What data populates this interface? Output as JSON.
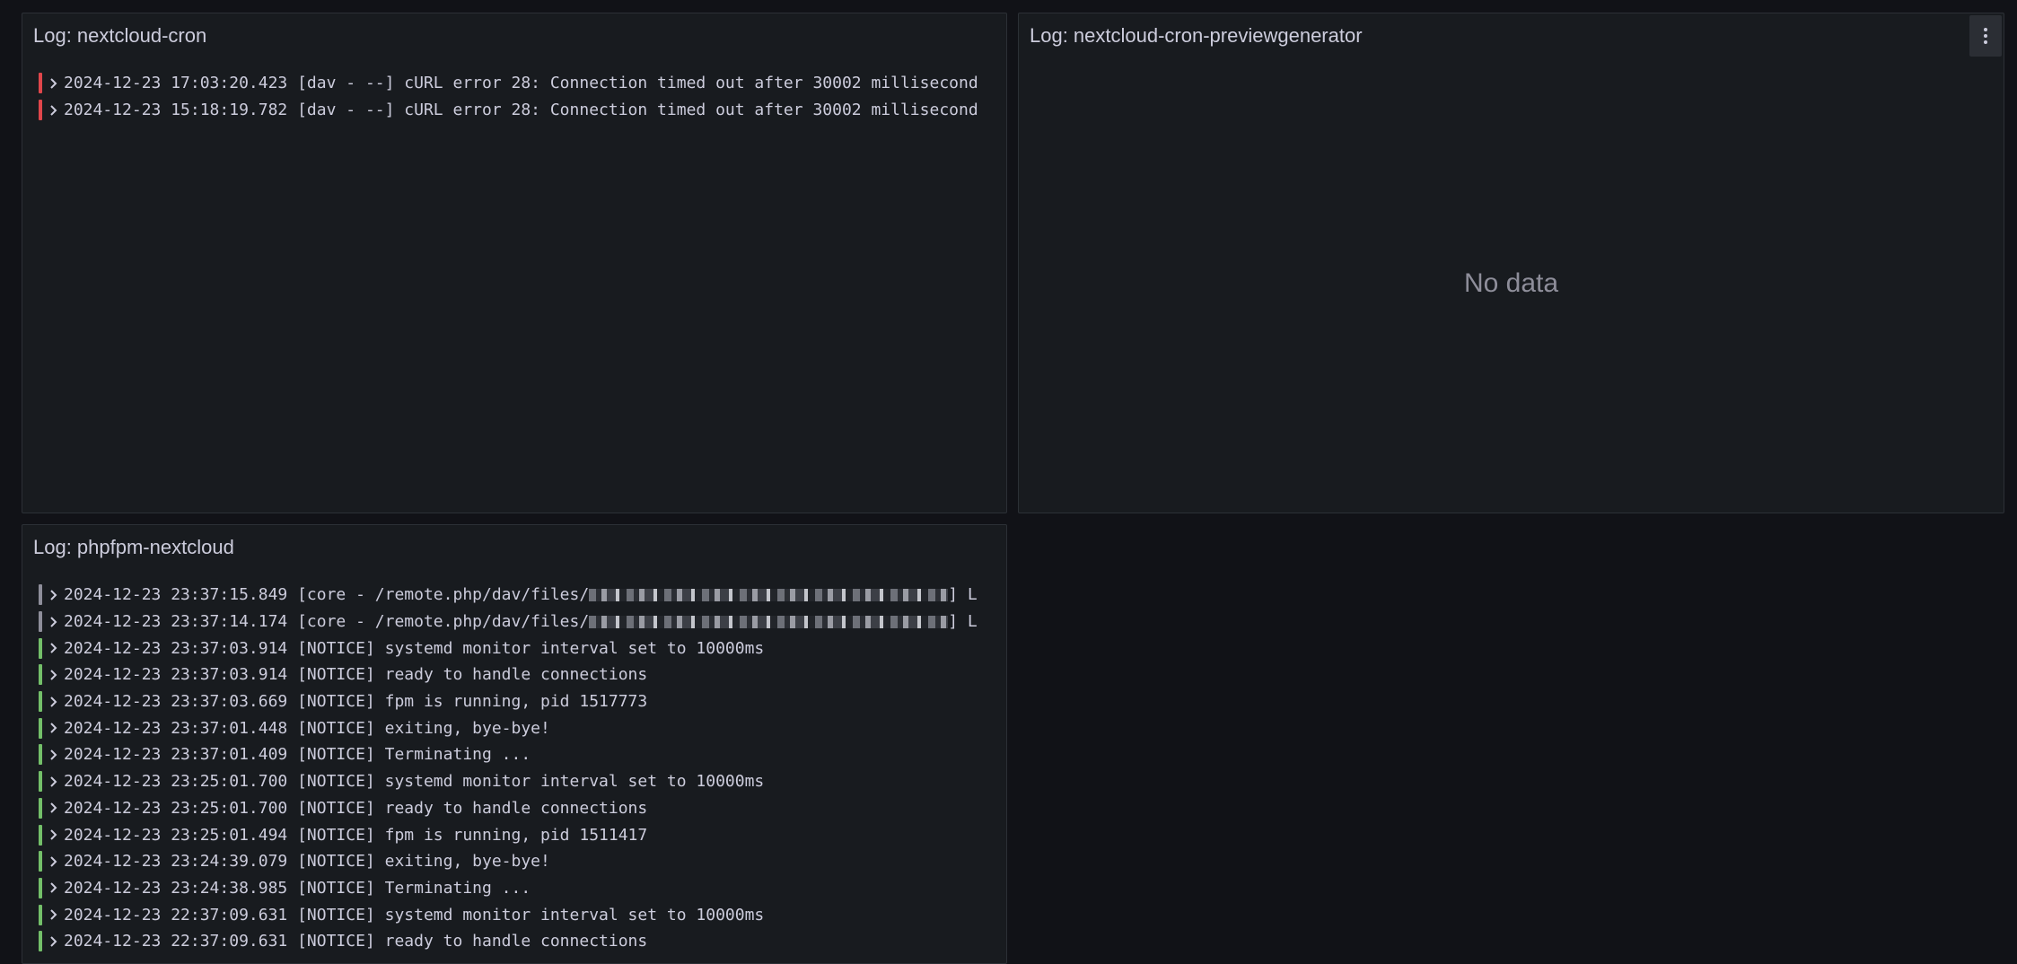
{
  "colors": {
    "error": "#e0464b",
    "notice": "#73bf69",
    "unknown": "#8e8e9a",
    "background": "#111217",
    "panel": "#181b1f"
  },
  "panels": {
    "cron": {
      "title": "Log: nextcloud-cron",
      "logs": [
        {
          "level": "error",
          "text": "2024-12-23 17:03:20.423 [dav - --] cURL error 28: Connection timed out after 30002 millisecond"
        },
        {
          "level": "error",
          "text": "2024-12-23 15:18:19.782 [dav - --] cURL error 28: Connection timed out after 30002 millisecond"
        }
      ]
    },
    "preview": {
      "title": "Log: nextcloud-cron-previewgenerator",
      "no_data": "No data",
      "menu_icon": "kebab-menu-icon"
    },
    "phpfpm": {
      "title": "Log: phpfpm-nextcloud",
      "redacted_logs": [
        {
          "level": "unknown",
          "prefix": "2024-12-23 23:37:15.849 [core - /remote.php/dav/files/",
          "suffix": "] L"
        },
        {
          "level": "unknown",
          "prefix": "2024-12-23 23:37:14.174 [core - /remote.php/dav/files/",
          "suffix": "] L"
        }
      ],
      "logs": [
        {
          "level": "notice",
          "text": "2024-12-23 23:37:03.914 [NOTICE] systemd monitor interval set to 10000ms"
        },
        {
          "level": "notice",
          "text": "2024-12-23 23:37:03.914 [NOTICE] ready to handle connections"
        },
        {
          "level": "notice",
          "text": "2024-12-23 23:37:03.669 [NOTICE] fpm is running, pid 1517773"
        },
        {
          "level": "notice",
          "text": "2024-12-23 23:37:01.448 [NOTICE] exiting, bye-bye!"
        },
        {
          "level": "notice",
          "text": "2024-12-23 23:37:01.409 [NOTICE] Terminating ..."
        },
        {
          "level": "notice",
          "text": "2024-12-23 23:25:01.700 [NOTICE] systemd monitor interval set to 10000ms"
        },
        {
          "level": "notice",
          "text": "2024-12-23 23:25:01.700 [NOTICE] ready to handle connections"
        },
        {
          "level": "notice",
          "text": "2024-12-23 23:25:01.494 [NOTICE] fpm is running, pid 1511417"
        },
        {
          "level": "notice",
          "text": "2024-12-23 23:24:39.079 [NOTICE] exiting, bye-bye!"
        },
        {
          "level": "notice",
          "text": "2024-12-23 23:24:38.985 [NOTICE] Terminating ..."
        },
        {
          "level": "notice",
          "text": "2024-12-23 22:37:09.631 [NOTICE] systemd monitor interval set to 10000ms"
        },
        {
          "level": "notice",
          "text": "2024-12-23 22:37:09.631 [NOTICE] ready to handle connections"
        }
      ]
    }
  }
}
